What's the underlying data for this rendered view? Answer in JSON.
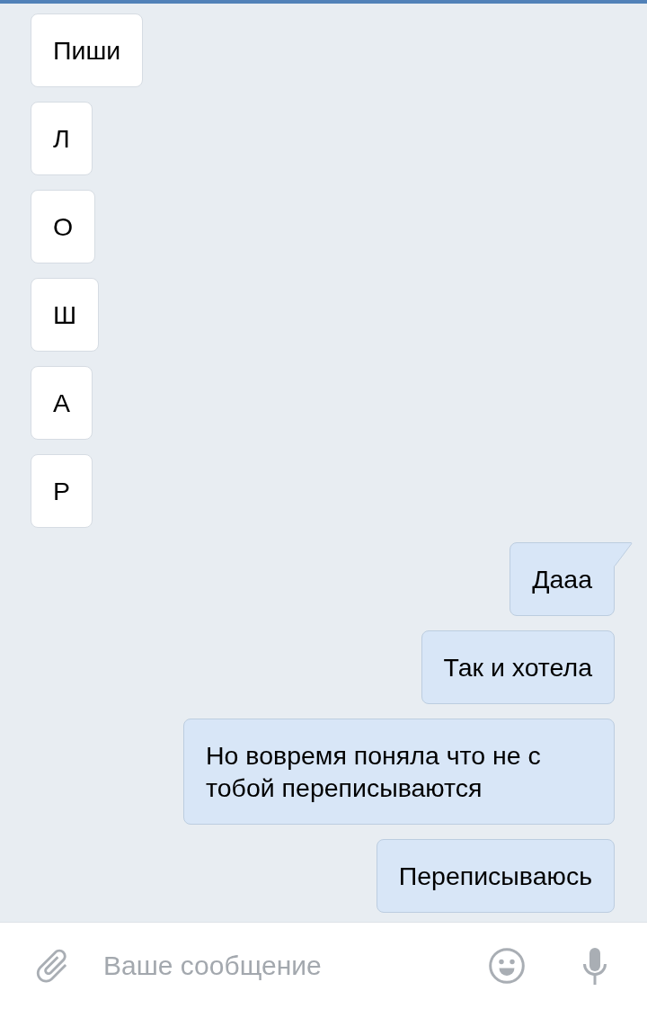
{
  "messages": [
    {
      "kind": "incoming",
      "text": "Пиши",
      "tail": false
    },
    {
      "kind": "incoming",
      "text": "Л",
      "tail": false
    },
    {
      "kind": "incoming",
      "text": "О",
      "tail": false
    },
    {
      "kind": "incoming",
      "text": "Ш",
      "tail": false
    },
    {
      "kind": "incoming",
      "text": "А",
      "tail": false
    },
    {
      "kind": "incoming",
      "text": "Р",
      "tail": false
    },
    {
      "kind": "outgoing",
      "text": "Дааа",
      "tail": true
    },
    {
      "kind": "outgoing",
      "text": "Так и хотела",
      "tail": false
    },
    {
      "kind": "outgoing",
      "text": "Но вовремя поняла что не с тобой переписываются",
      "tail": false
    },
    {
      "kind": "outgoing",
      "text": "Переписываюсь",
      "tail": false
    }
  ],
  "composer": {
    "placeholder": "Ваше сообщение"
  }
}
